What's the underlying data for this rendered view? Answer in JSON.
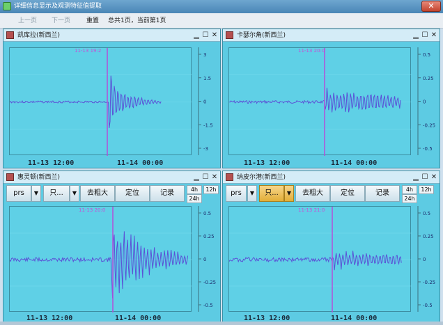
{
  "window": {
    "title": "详细信息显示及观测特征值提取",
    "close_label": "✕"
  },
  "toolbar": {
    "prev_label": "上一页",
    "next_label": "下一页",
    "reset_label": "重置",
    "status": "总共1页，当前第1页"
  },
  "panels": [
    {
      "title": "凯库拉(新西兰)",
      "marker_time": "11-13 19:2",
      "x_labels": [
        "11-13 12:00",
        "11-14 00:00"
      ],
      "y_ticks": [
        "3",
        "1.5",
        "0",
        "-1.5",
        "-3"
      ]
    },
    {
      "title": "卡瑟尔角(新西兰)",
      "marker_time": "11-13 20:0",
      "x_labels": [
        "11-13 12:00",
        "11-14 00:00"
      ],
      "y_ticks": [
        "0.5",
        "0.25",
        "0",
        "-0.25",
        "-0.5"
      ]
    },
    {
      "title": "惠灵顿(新西兰)",
      "marker_time": "11-13 20:0",
      "x_labels": [
        "11-13 12:00",
        "11-14 00:00"
      ],
      "y_ticks": [
        "0.5",
        "0.25",
        "0",
        "-0.25",
        "-0.5"
      ],
      "controls": {
        "channel": "prs",
        "mode": "只...",
        "denoise": "去粗大",
        "locate": "定位",
        "record": "记录",
        "r4h": "4h",
        "r12h": "12h",
        "r24h": "24h"
      }
    },
    {
      "title": "纳皮尔港(新西兰)",
      "marker_time": "11-13 21:0",
      "x_labels": [
        "11-13 12:00",
        "11-14 00:00"
      ],
      "y_ticks": [
        "0.5",
        "0.25",
        "0",
        "-0.25",
        "-0.5"
      ],
      "controls": {
        "channel": "prs",
        "mode": "只...",
        "denoise": "去粗大",
        "locate": "定位",
        "record": "记录",
        "r4h": "4h",
        "r12h": "12h",
        "r24h": "24h"
      }
    }
  ],
  "colors": {
    "trace": "#5a52d6",
    "marker": "#b44fd8",
    "plot_bg": "#5fd0e6"
  }
}
